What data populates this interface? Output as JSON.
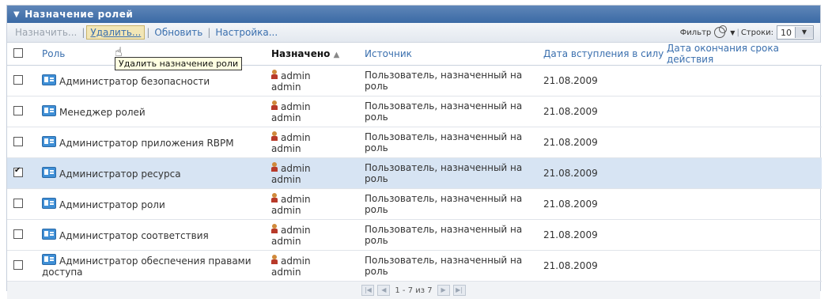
{
  "panel": {
    "title": "Назначение ролей"
  },
  "toolbar": {
    "assign": "Назначить...",
    "delete": "Удалить...",
    "refresh": "Обновить",
    "settings": "Настройка...",
    "filter_label": "Фильтр",
    "rows_label": "Строки:",
    "rows_value": "10"
  },
  "tooltip": "Удалить назначение роли",
  "table": {
    "headers": {
      "role": "Роль",
      "assigned": "Назначено",
      "source": "Источник",
      "effective_date": "Дата вступления в силу",
      "expiration_date": "Дата окончания срока действия"
    },
    "rows": [
      {
        "role": "Администратор безопасности",
        "assigned_icon_name": "admin",
        "assigned_name": "admin",
        "source": "Пользователь, назначенный на роль",
        "effective_date": "21.08.2009",
        "checked": false
      },
      {
        "role": "Менеджер ролей",
        "assigned_icon_name": "admin",
        "assigned_name": "admin",
        "source": "Пользователь, назначенный на роль",
        "effective_date": "21.08.2009",
        "checked": false
      },
      {
        "role": "Администратор приложения RBPM",
        "assigned_icon_name": "admin",
        "assigned_name": "admin",
        "source": "Пользователь, назначенный на роль",
        "effective_date": "21.08.2009",
        "checked": false
      },
      {
        "role": "Администратор ресурса",
        "assigned_icon_name": "admin",
        "assigned_name": "admin",
        "source": "Пользователь, назначенный на роль",
        "effective_date": "21.08.2009",
        "checked": true
      },
      {
        "role": "Администратор роли",
        "assigned_icon_name": "admin",
        "assigned_name": "admin",
        "source": "Пользователь, назначенный на роль",
        "effective_date": "21.08.2009",
        "checked": false
      },
      {
        "role": "Администратор соответствия",
        "assigned_icon_name": "admin",
        "assigned_name": "admin",
        "source": "Пользователь, назначенный на роль",
        "effective_date": "21.08.2009",
        "checked": false
      },
      {
        "role": "Администратор обеспечения правами доступа",
        "assigned_icon_name": "admin",
        "assigned_name": "admin",
        "source": "Пользователь, назначенный на роль",
        "effective_date": "21.08.2009",
        "checked": false
      }
    ]
  },
  "pager": {
    "text": "1 - 7 из 7"
  }
}
